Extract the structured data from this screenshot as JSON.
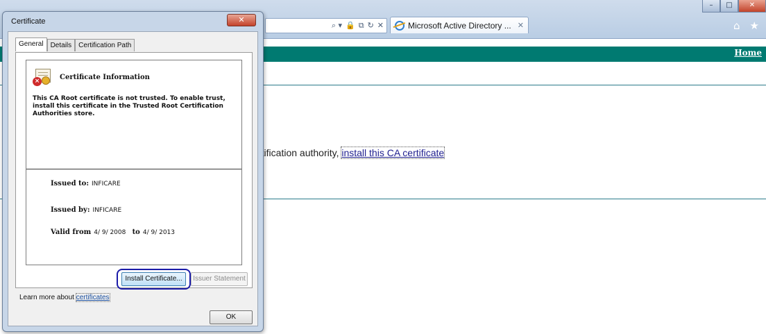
{
  "browser": {
    "tab_title": "Microsoft Active Directory ...",
    "tab_close": "✕",
    "address_icons": [
      "⌕ ▾",
      "🔒",
      "⧉",
      "↻",
      "✕"
    ],
    "window_controls": {
      "minimize": "–",
      "maximize": "□",
      "close": "✕"
    },
    "toolbar": {
      "home_icon": "⌂",
      "favorites_icon": "★"
    }
  },
  "page": {
    "home_link": "Home",
    "text_prefix": "rtification authority, ",
    "install_link": "install this CA certificate"
  },
  "dialog": {
    "title": "Certificate",
    "close_label": "✕",
    "tabs": [
      {
        "label": "General"
      },
      {
        "label": "Details"
      },
      {
        "label": "Certification Path"
      }
    ],
    "info_title": "Certificate Information",
    "info_message": "This CA Root certificate is not trusted. To enable trust, install this certificate in the Trusted Root Certification Authorities store.",
    "issued_to_label": "Issued to:",
    "issued_to_value": "INFICARE",
    "issued_by_label": "Issued by:",
    "issued_by_value": "INFICARE",
    "valid_from_label": "Valid from",
    "valid_from_value": "4/ 9/ 2008",
    "valid_to_label": "to",
    "valid_to_value": "4/ 9/ 2013",
    "install_button": "Install Certificate...",
    "issuer_button": "Issuer Statement",
    "learn_more_text": "Learn more about ",
    "learn_more_link": "certificates",
    "ok_button": "OK"
  }
}
